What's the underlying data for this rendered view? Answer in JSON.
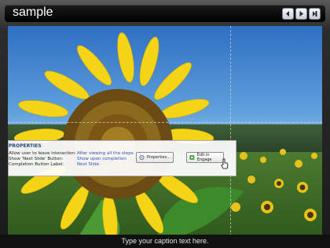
{
  "window": {
    "title": "sample"
  },
  "nav": {
    "icons": [
      "prev-icon",
      "play-icon",
      "next-icon"
    ]
  },
  "properties": {
    "heading": "PROPERTIES",
    "rows": [
      {
        "label": "Allow user to leave interaction:",
        "value": "After viewing all the steps"
      },
      {
        "label": "Show 'Next Slide' Button:",
        "value": "Show upon completion"
      },
      {
        "label": "Completion Button Label:",
        "value": "Next Slide"
      }
    ],
    "properties_button": "Properties...",
    "edit_button": "Edit in Engage"
  },
  "caption": {
    "text": "Type your caption text here."
  },
  "colors": {
    "accent": "#2b4dc4",
    "title_bg": "#000000",
    "caption_bg": "#111111"
  }
}
